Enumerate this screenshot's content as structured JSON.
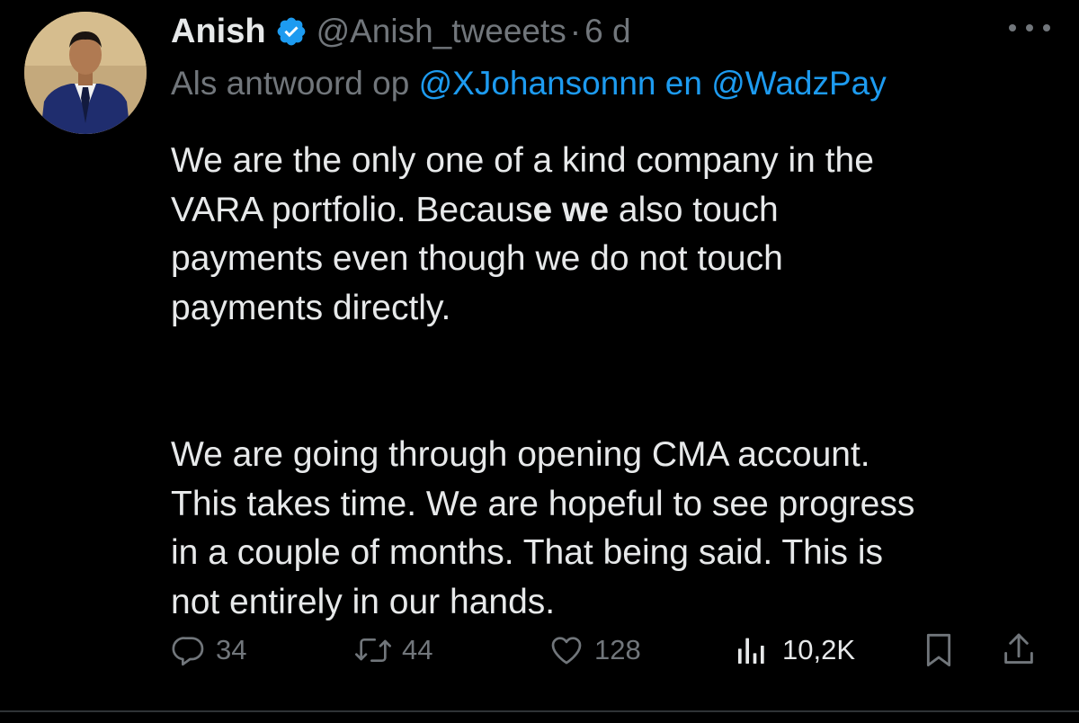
{
  "tweet": {
    "author": {
      "name": "Anish",
      "handle": "@Anish_tweeets",
      "separator": "·",
      "time": "6 d",
      "verified_icon": "verified-badge-icon"
    },
    "reply_to": {
      "prefix": "Als antwoord op",
      "mention_1": "@XJohansonnn",
      "joiner": "en",
      "mention_2": "@WadzPay"
    },
    "body": {
      "paragraph_1": {
        "line_1": "We are the only one of a kind company in the",
        "line_2_before": "VARA portfolio. Becaus",
        "line_2_bold": "e we",
        "line_2_after": " also touch",
        "line_3": "payments even though we do not touch",
        "line_4": "payments directly."
      },
      "paragraph_2": {
        "line_1": "We are going through opening CMA account.",
        "line_2": "This takes time. We are hopeful to see progress",
        "line_3": "in a couple of months. That being said. This is",
        "line_4": "not entirely in our hands."
      }
    },
    "actions": {
      "reply": {
        "count": "34",
        "icon": "reply-icon"
      },
      "retweet": {
        "count": "44",
        "icon": "retweet-icon"
      },
      "like": {
        "count": "128",
        "icon": "heart-icon"
      },
      "views": {
        "count": "10,2K",
        "icon": "views-icon"
      },
      "bookmark": {
        "icon": "bookmark-icon"
      },
      "share": {
        "icon": "share-icon"
      }
    }
  },
  "colors": {
    "background": "#000000",
    "text_primary": "#e7e9ea",
    "text_secondary": "#71767b",
    "accent": "#1d9bf0"
  }
}
